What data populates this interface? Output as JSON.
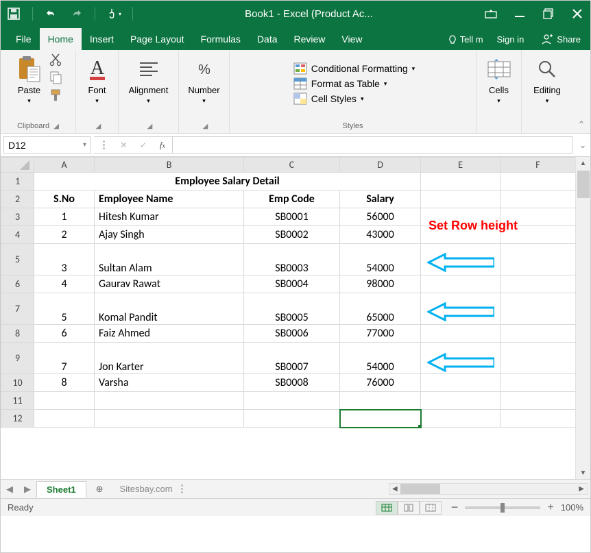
{
  "window_title": "Book1 - Excel (Product Ac...",
  "tabs": {
    "file": "File",
    "home": "Home",
    "insert": "Insert",
    "pagelayout": "Page Layout",
    "formulas": "Formulas",
    "data": "Data",
    "review": "Review",
    "view": "View",
    "tellme": "Tell m",
    "signin": "Sign in",
    "share": "Share"
  },
  "ribbon": {
    "clipboard": "Clipboard",
    "paste": "Paste",
    "font": "Font",
    "alignment": "Alignment",
    "number": "Number",
    "cond_fmt": "Conditional Formatting",
    "fmt_table": "Format as Table",
    "cell_styles": "Cell Styles",
    "styles": "Styles",
    "cells": "Cells",
    "editing": "Editing"
  },
  "namebox": "D12",
  "columns": [
    "A",
    "B",
    "C",
    "D",
    "E",
    "F"
  ],
  "title_row": "Employee Salary Detail",
  "headers": {
    "sno": "S.No",
    "ename": "Employee Name",
    "ecode": "Emp Code",
    "salary": "Salary"
  },
  "rows": [
    {
      "n": "1",
      "name": "Hitesh Kumar",
      "code": "SB0001",
      "sal": "56000",
      "tall": false
    },
    {
      "n": "2",
      "name": "Ajay Singh",
      "code": "SB0002",
      "sal": "43000",
      "tall": false
    },
    {
      "n": "3",
      "name": "Sultan Alam",
      "code": "SB0003",
      "sal": "54000",
      "tall": true
    },
    {
      "n": "4",
      "name": "Gaurav Rawat",
      "code": "SB0004",
      "sal": "98000",
      "tall": false
    },
    {
      "n": "5",
      "name": "Komal Pandit",
      "code": "SB0005",
      "sal": "65000",
      "tall": true
    },
    {
      "n": "6",
      "name": "Faiz Ahmed",
      "code": "SB0006",
      "sal": "77000",
      "tall": false
    },
    {
      "n": "7",
      "name": "Jon Karter",
      "code": "SB0007",
      "sal": "54000",
      "tall": true
    },
    {
      "n": "8",
      "name": "Varsha",
      "code": "SB0008",
      "sal": "76000",
      "tall": false
    }
  ],
  "row_labels": [
    "1",
    "2",
    "3",
    "4",
    "5",
    "6",
    "7",
    "8",
    "9",
    "10",
    "11",
    "12"
  ],
  "annotation": "Set Row height",
  "sheet_tab": "Sheet1",
  "credit": "Sitesbay.com",
  "status": "Ready",
  "zoom": "100%",
  "colors": {
    "accent": "#0c7440",
    "arrow": "#00b0f0",
    "anno": "#ff0000"
  }
}
